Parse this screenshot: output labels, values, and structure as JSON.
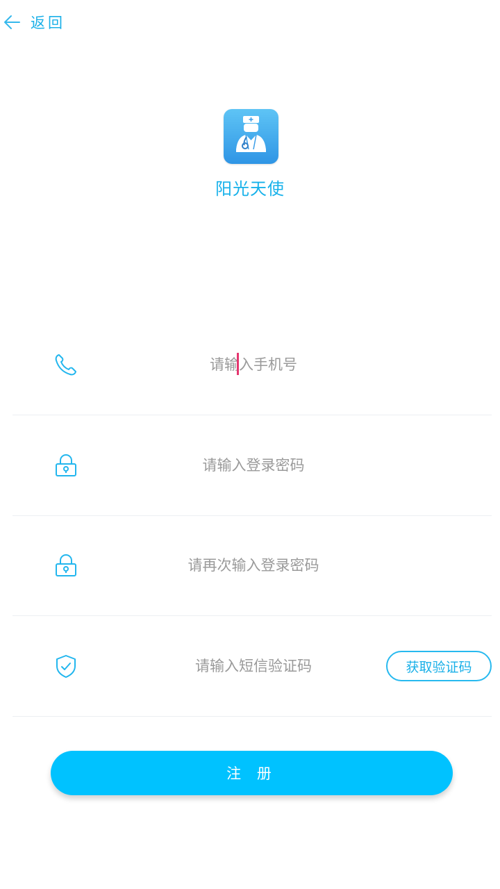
{
  "header": {
    "back_label": "返回"
  },
  "app": {
    "name": "阳光天使",
    "logo_icon": "doctor-icon"
  },
  "form": {
    "phone": {
      "placeholder": "请输入手机号",
      "icon": "phone-icon"
    },
    "password": {
      "placeholder": "请输入登录密码",
      "icon": "lock-icon"
    },
    "confirm_password": {
      "placeholder": "请再次输入登录密码",
      "icon": "lock-icon"
    },
    "sms_code": {
      "placeholder": "请输入短信验证码",
      "icon": "shield-check-icon",
      "button_label": "获取验证码"
    }
  },
  "actions": {
    "register_label": "注 册"
  },
  "colors": {
    "accent": "#1ab0e8",
    "button": "#00c2ff",
    "caret": "#e5366f"
  }
}
